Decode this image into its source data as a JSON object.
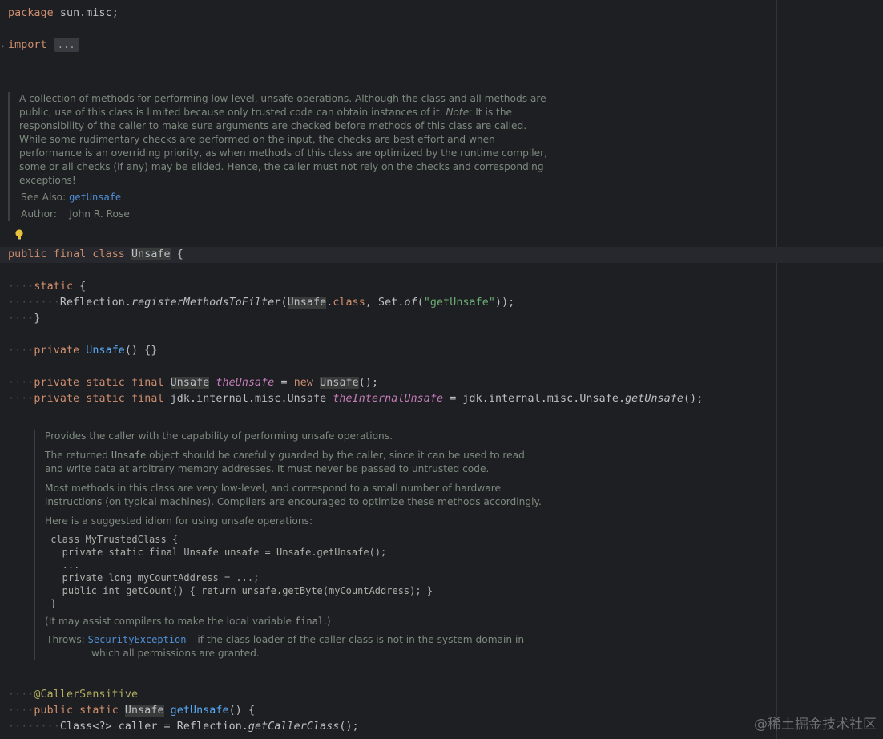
{
  "code": {
    "package_kw": "package",
    "package_name": " sun.misc;",
    "import_kw": "import",
    "import_folded": "...",
    "class_decl": {
      "public": "public",
      "final": "final",
      "class": "class",
      "name": "Unsafe",
      "brace": " {"
    },
    "static_block": {
      "dots": "····",
      "kw": "static",
      "open": " {",
      "inner_dots": "····",
      "call_prefix": "Reflection.",
      "call_method": "registerMethodsToFilter",
      "open_paren": "(",
      "arg_class": "Unsafe",
      "dot": ".",
      "class_kw": "class",
      "comma_set": ", Set.",
      "of": "of",
      "paren": "(",
      "str": "\"getUnsafe\"",
      "close": "));",
      "close_brace": "}"
    },
    "ctor": {
      "private": "private",
      "name": "Unsafe",
      "rest": "() {}"
    },
    "field1": {
      "private": "private",
      "static": "static",
      "final": "final",
      "type": "Unsafe",
      "name": "theUnsafe",
      "eq": " = ",
      "new": "new",
      "ctor": "Unsafe",
      "rest": "();"
    },
    "field2": {
      "private": "private",
      "static": "static",
      "final": "final",
      "type": " jdk.internal.misc.Unsafe ",
      "name": "theInternalUnsafe",
      "eq": " = jdk.internal.misc.Unsafe.",
      "call": "getUnsafe",
      "rest": "();"
    },
    "annotation": "@CallerSensitive",
    "method": {
      "public": "public",
      "static": "static",
      "type": "Unsafe",
      "name": "getUnsafe",
      "rest": "() {"
    },
    "body1": {
      "dots": "········",
      "decl": "Class<?> caller = Reflection.",
      "call": "getCallerClass",
      "rest": "();"
    }
  },
  "doc1": {
    "para1": "A collection of methods for performing low-level, unsafe operations. Although the class and all methods are public, use of this class is limited because only trusted code can obtain instances of it.",
    "note_label": "Note:",
    "para2": " It is the responsibility of the caller to make sure arguments are checked before methods of this class are called. While some rudimentary checks are performed on the input, the checks are best effort and when performance is an overriding priority, as when methods of this class are optimized by the runtime compiler, some or all checks (if any) may be elided. Hence, the caller must not rely on the checks and corresponding exceptions!",
    "see_also_label": "See Also:",
    "see_also_link": "getUnsafe",
    "author_label": "Author:",
    "author_name": "John R. Rose"
  },
  "doc2": {
    "p1": "Provides the caller with the capability of performing unsafe operations.",
    "p2a": "The returned ",
    "p2_mono": "Unsafe",
    "p2b": " object should be carefully guarded by the caller, since it can be used to read and write data at arbitrary memory addresses. It must never be passed to untrusted code.",
    "p3": "Most methods in this class are very low-level, and correspond to a small number of hardware instructions (on typical machines). Compilers are encouraged to optimize these methods accordingly.",
    "p4": "Here is a suggested idiom for using unsafe operations:",
    "code": " class MyTrustedClass {\n   private static final Unsafe unsafe = Unsafe.getUnsafe();\n   ...\n   private long myCountAddress = ...;\n   public int getCount() { return unsafe.getByte(myCountAddress); }\n }",
    "p5a": "(It may assist compilers to make the local variable ",
    "p5_mono": "final",
    "p5b": ".)",
    "throws_label": "Throws:",
    "throws_link": "SecurityException",
    "throws_text": " – if the class loader of the caller class is not in the system domain in which all permissions are granted."
  },
  "watermark": "@稀土掘金技术社区",
  "colors": {
    "background": "#1e1f22",
    "keyword": "#cf8e6d",
    "string": "#6aab73",
    "function": "#56a8f5",
    "field": "#c77dbb",
    "annotation": "#b3ae60",
    "doc_text": "#7d8a7f",
    "link": "#4f8fd6"
  },
  "icons": {
    "fold": "chevron-right-icon",
    "intention": "lightbulb-icon"
  }
}
